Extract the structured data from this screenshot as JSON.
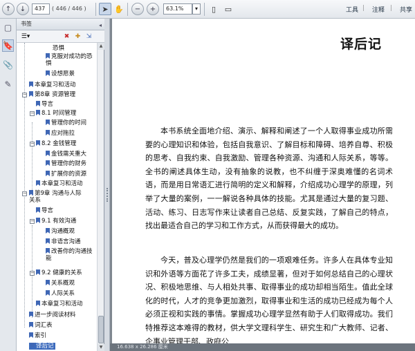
{
  "toolbar": {
    "page_current": "437",
    "page_total": "( 446 / 446 )",
    "zoom": "63.1%",
    "menu_tools": "工具",
    "menu_comment": "注释",
    "menu_share": "共享"
  },
  "bookmarks": {
    "panel_title": "书签",
    "items": [
      "恐惧",
      "克服对成功的恐惧",
      "设想愿景",
      "本章复习和活动",
      "第8章  资源管理",
      "导言",
      "8.1  时间管理",
      "管理你的时间",
      "应对拖拉",
      "8.2  金钱管理",
      "金钱需关重大",
      "管理你的财务",
      "扩展你的资源",
      "本章复习和活动",
      "第9章  沟通与人际关系",
      "导言",
      "9.1  有效沟通",
      "沟通概观",
      "非语言沟通",
      "改善你的沟通技能",
      "9.2  健康的关系",
      "关系概观",
      "人际关系",
      "本章复习和活动",
      "进一步阅读材料",
      "词汇表",
      "索引",
      "译后记"
    ]
  },
  "document": {
    "title": "译后记",
    "paragraph1": "本书系统全面地介绍、演示、解释和阐述了一个人取得事业成功所需要的心理知识和体验，包括自我意识、了解目标和障碍、培养自尊、积极的思考、自我约束、自我激励、管理各种资源、沟通和人际关系，等等。全书的阐述具体生动，没有抽象的说教，也不纠缠于深奥难懂的名词术语，而是用日常语汇进行简明的定义和解释，介绍成功心理学的原理，列举了大量的案例，一一解说各种具体的技能。尤其是通过大量的复习题、活动、练习、日志写作来让读者自己总结、反复实践，了解自己的特点，找出最适合自己的学习和工作方式，从而获得最大的成功。",
    "paragraph2": "今天，普及心理学仍然是我们的一项艰难任务。许多人在具体专业知识和外语等方面花了许多工夫，成绩显著，但对于如何总结自己的心理状况、积极地思维、与人相处共事、取得事业的成功却相当陌生。值此全球化的时代，人才的竞争更加激烈，取得事业和生活的成功已经成为每个人必须正视和实践的事情。掌握成功心理学显然有助于人们取得成功。我们特推荐这本难得的教材，供大学文理科学生、研究生和广大教师、记者、企事业管理干部、政府公"
  },
  "status": {
    "page_size": "16.638 x 26.286 厘米"
  }
}
